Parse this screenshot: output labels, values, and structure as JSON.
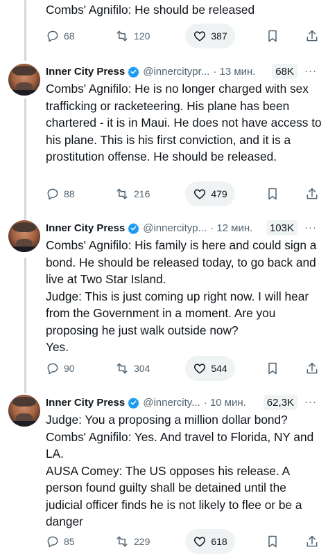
{
  "top": {
    "text": "Combs' Agnifilo: He should be released",
    "replies": "68",
    "retweets": "120",
    "likes": "387"
  },
  "tweets": [
    {
      "name": "Inner City Press",
      "handle": "@innercitypr...",
      "time": "· 13 мин.",
      "views": "68K",
      "lines": [
        "Combs' Agnifilo: He is no longer charged with sex trafficking or racketeering. His plane has been chartered - it is in Maui. He does not have access to his plane. This is his first conviction, and it is a prostitution offense. He should be released."
      ],
      "replies": "88",
      "retweets": "216",
      "likes": "479"
    },
    {
      "name": "Inner City Press",
      "handle": "@innercityp...",
      "time": "· 12 мин.",
      "views": "103K",
      "lines": [
        "Combs' Agnifilo: His family is here and could sign a bond. He should be released today, to go back and live at Two Star Island.",
        "Judge: This is just coming up right now. I will hear from the Government in a moment. Are you proposing he just walk outside now?",
        "Yes."
      ],
      "replies": "90",
      "retweets": "304",
      "likes": "544"
    },
    {
      "name": "Inner City Press",
      "handle": "@innercity...",
      "time": "· 10 мин.",
      "views": "62,3K",
      "lines": [
        "Judge: You a proposing a million dollar bond?",
        "Combs' Agnifilo: Yes. And travel to Florida, NY and LA.",
        "AUSA Comey: The US opposes his release. A person  found guilty shall be detained until the judicial officer finds he is not likely to flee or be a danger"
      ],
      "replies": "85",
      "retweets": "229",
      "likes": "618"
    }
  ],
  "more_label": "···",
  "colors": {
    "text": "#0f1419",
    "muted": "#536471",
    "verified": "#1d9bf0",
    "pill": "#eff3f4",
    "line": "#cfd9de"
  }
}
